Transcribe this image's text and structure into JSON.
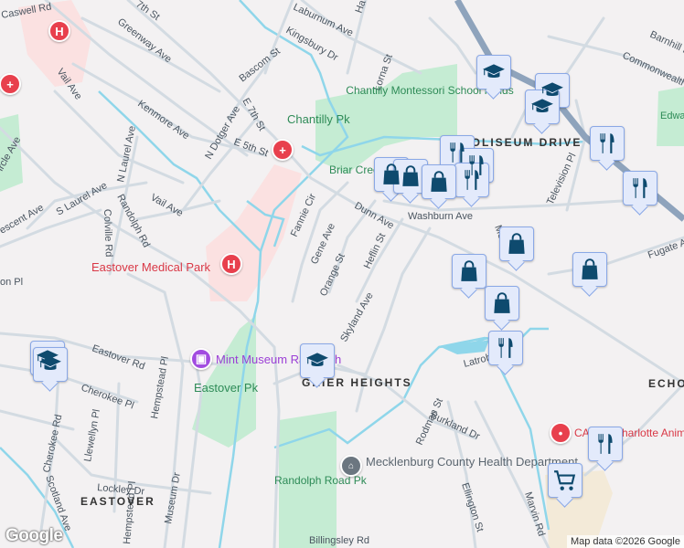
{
  "colors": {
    "background": "#f3f1f2",
    "park": "#c5ecd3",
    "water": "#8fd6ea",
    "medical_area": "#fbe1e1",
    "road": "#d3dbe2",
    "highway": "#8ea3bc",
    "marker_fill": "#e3eafb",
    "marker_icon": "#0e4a6e",
    "hospital": "#e8404d",
    "museum": "#a24ce0",
    "commercial": "#f3ead8"
  },
  "streets": [
    "Caswell Rd",
    "7th St",
    "Greenway Ave",
    "Bascom St",
    "Kingsbury Dr",
    "Laburnum Ave",
    "Lorna St",
    "Vail Ave",
    "Kenmore Ave",
    "N Dotger Ave",
    "E 7th St",
    "E 5th St",
    "N Laurel Ave",
    "Vail Ave",
    "S Laurel Ave",
    "Colville Rd",
    "Randolph Rd",
    "Fannie Cir",
    "Gene Ave",
    "Orange St",
    "Dunn Ave",
    "Heflin St",
    "Washburn Ave",
    "Television Pl",
    "Commonwealth Ave",
    "Barnhill Dr",
    "Fugate Ave",
    "Skyland Ave",
    "Cherokee Rd",
    "Cherokee Pl",
    "Eastover Rd",
    "Hempstead Pl",
    "Llewellyn Pl",
    "Lockley Dr",
    "Museum Dr",
    "Scotland Ave",
    "Rodman St",
    "Burkland Dr",
    "Latrobe Dr",
    "Marvin Rd",
    "Ellington St",
    "Hempstead Pl",
    "ircle Ave",
    "escent Ave",
    "on Pl",
    "Ha",
    "Mo",
    "Billingsley Rd"
  ],
  "places": {
    "parks": [
      "Chantilly Pk",
      "Chantilly Montessori School Fields",
      "Briar Creek Greenway",
      "Eastover Pk",
      "Randolph Road Pk",
      "Edwards Branch Greenway"
    ],
    "neighborhoods": [
      "COLISEUM DRIVE",
      "GRIER HEIGHTS",
      "EASTOVER",
      "ECHO"
    ],
    "medical": [
      "Eastover Medical Park",
      "CAPE - Charlotte Animal Referral & Emergency"
    ],
    "museum": "Mint Museum Randolph",
    "government": "Mecklenburg County Health Department"
  },
  "markers": [
    {
      "type": "school-icon"
    },
    {
      "type": "school-icon"
    },
    {
      "type": "school-icon"
    },
    {
      "type": "school-icon"
    },
    {
      "type": "school-icon"
    },
    {
      "type": "school-icon"
    },
    {
      "type": "restaurant-icon"
    },
    {
      "type": "restaurant-icon"
    },
    {
      "type": "restaurant-icon"
    },
    {
      "type": "restaurant-icon"
    },
    {
      "type": "restaurant-icon"
    },
    {
      "type": "restaurant-icon"
    },
    {
      "type": "restaurant-icon"
    },
    {
      "type": "shopping-bag-icon"
    },
    {
      "type": "shopping-bag-icon"
    },
    {
      "type": "shopping-bag-icon"
    },
    {
      "type": "shopping-bag-icon"
    },
    {
      "type": "shopping-bag-icon"
    },
    {
      "type": "shopping-bag-icon"
    },
    {
      "type": "shopping-bag-icon"
    },
    {
      "type": "grocery-cart-icon"
    }
  ],
  "attribution": "Map data ©2026 Google",
  "logo": "Google"
}
